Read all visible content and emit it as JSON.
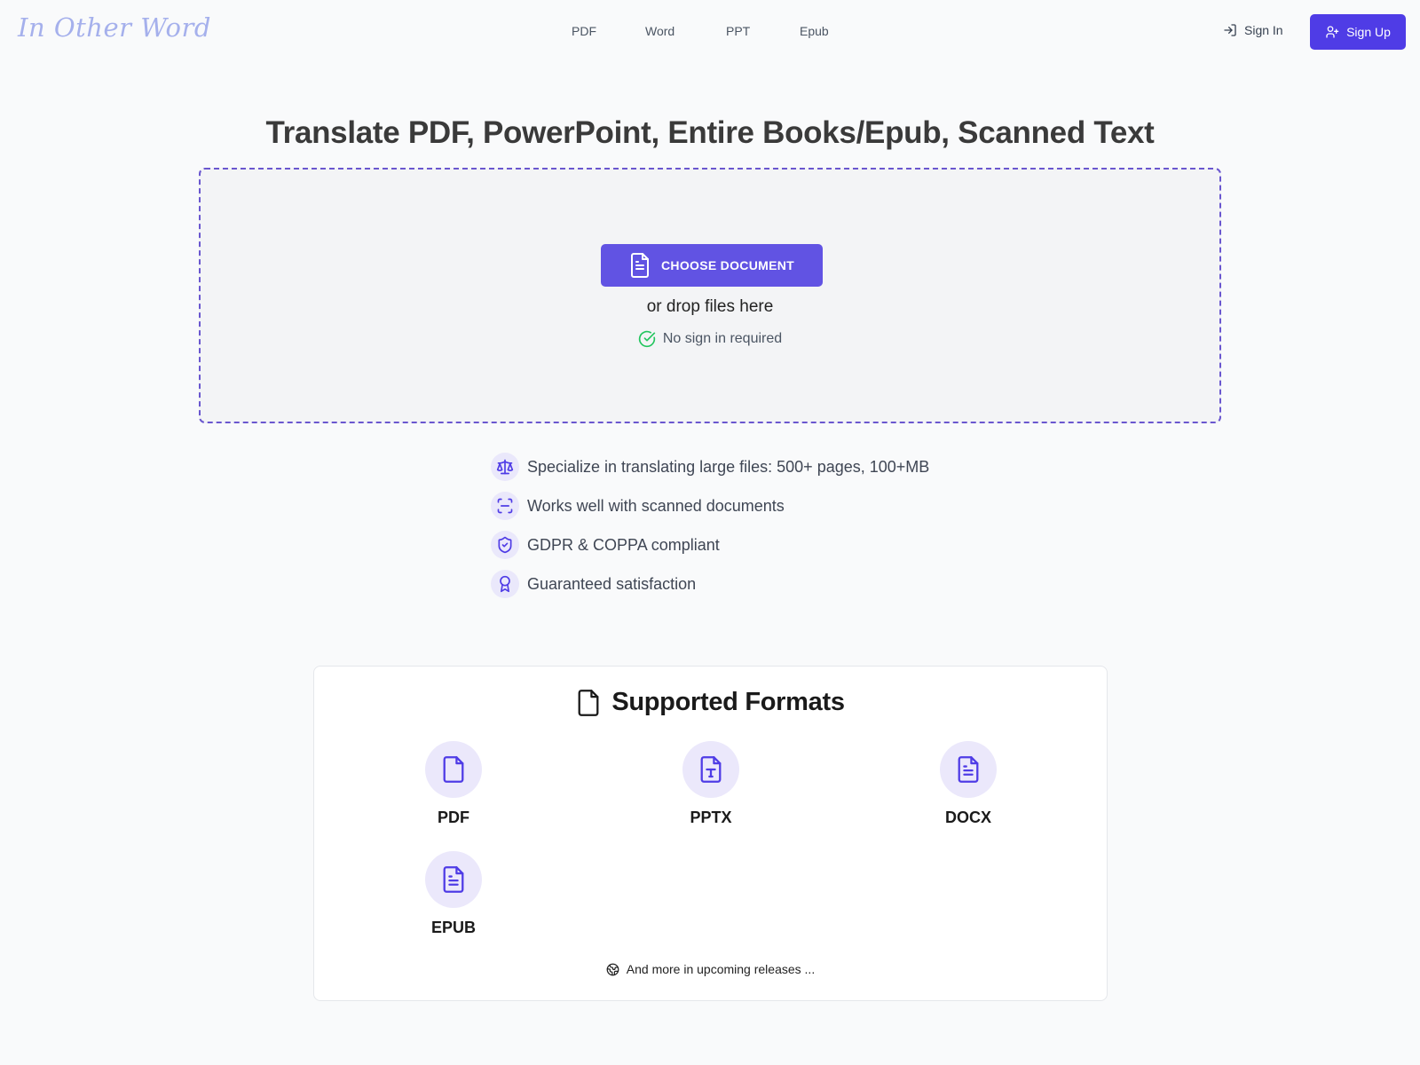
{
  "header": {
    "logo": "In Other Word",
    "nav": [
      {
        "label": "PDF"
      },
      {
        "label": "Word"
      },
      {
        "label": "PPT"
      },
      {
        "label": "Epub"
      }
    ],
    "sign_in": "Sign In",
    "sign_up": "Sign Up"
  },
  "main": {
    "title": "Translate PDF, PowerPoint, Entire Books/Epub, Scanned Text",
    "dropzone": {
      "button_label": "CHOOSE DOCUMENT",
      "drop_text": "or drop files here",
      "no_sign_in": "No sign in required"
    },
    "features": [
      {
        "icon": "scale-icon",
        "text": "Specialize in translating large files: 500+ pages, 100+MB"
      },
      {
        "icon": "scan-icon",
        "text": "Works well with scanned documents"
      },
      {
        "icon": "shield-check-icon",
        "text": "GDPR & COPPA compliant"
      },
      {
        "icon": "award-icon",
        "text": "Guaranteed satisfaction"
      }
    ]
  },
  "formats": {
    "title": "Supported Formats",
    "items": [
      {
        "label": "PDF",
        "icon": "file-icon"
      },
      {
        "label": "PPTX",
        "icon": "file-type-icon"
      },
      {
        "label": "DOCX",
        "icon": "file-text-icon"
      },
      {
        "label": "EPUB",
        "icon": "file-text-icon"
      }
    ],
    "more": "And more in upcoming releases ..."
  },
  "colors": {
    "accent": "#4f3ce6",
    "button": "#6153e3",
    "success": "#22c55e",
    "logo": "#a5b0ec"
  }
}
